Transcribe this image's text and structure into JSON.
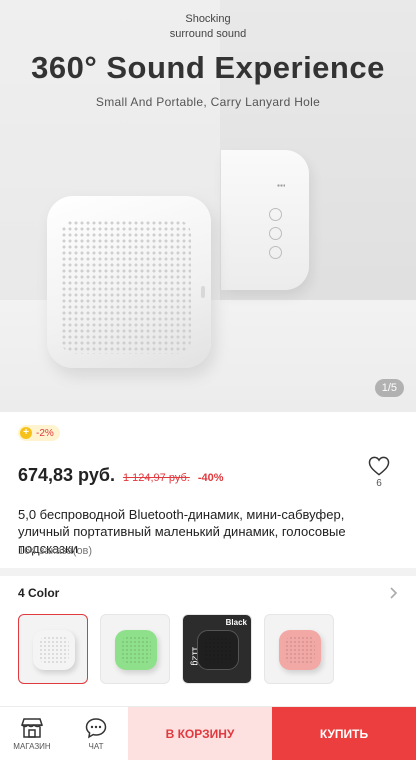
{
  "hero": {
    "tagline": "Shocking\nsurround sound",
    "headline": "360° Sound Experience",
    "subheadline": "Small And Portable, Carry Lanyard Hole",
    "counter": "1/5"
  },
  "promo": {
    "coin_symbol": "+",
    "badge": "-2%"
  },
  "product": {
    "price": "674,83 руб.",
    "old_price": "1 124,97 руб.",
    "discount": "-40%",
    "wishlist_count": "6",
    "title": "5,0 беспроводной Bluetooth-динамик, мини-сабвуфер, уличный портативный маленький динамик, голосовые подсказки",
    "orders": "164 заказа(ов)"
  },
  "colors": {
    "header": "4 Color",
    "options": [
      {
        "name": "white",
        "swatch": "#f4f4f4",
        "selected": true
      },
      {
        "name": "green",
        "swatch": "#8fe08a",
        "selected": false
      },
      {
        "name": "black",
        "swatch": "#2b2b2b",
        "selected": false,
        "tag": "Black",
        "weight_label": "112g"
      },
      {
        "name": "pink",
        "swatch": "#f2a9a6",
        "selected": false
      }
    ]
  },
  "bottom_bar": {
    "store_label": "МАГАЗИН",
    "chat_label": "ЧАТ",
    "cart_label": "В КОРЗИНУ",
    "buy_label": "КУПИТЬ"
  },
  "theme": {
    "accent": "#ec3e3e",
    "accent_light": "#fde0e0",
    "price_red": "#e0393e"
  }
}
